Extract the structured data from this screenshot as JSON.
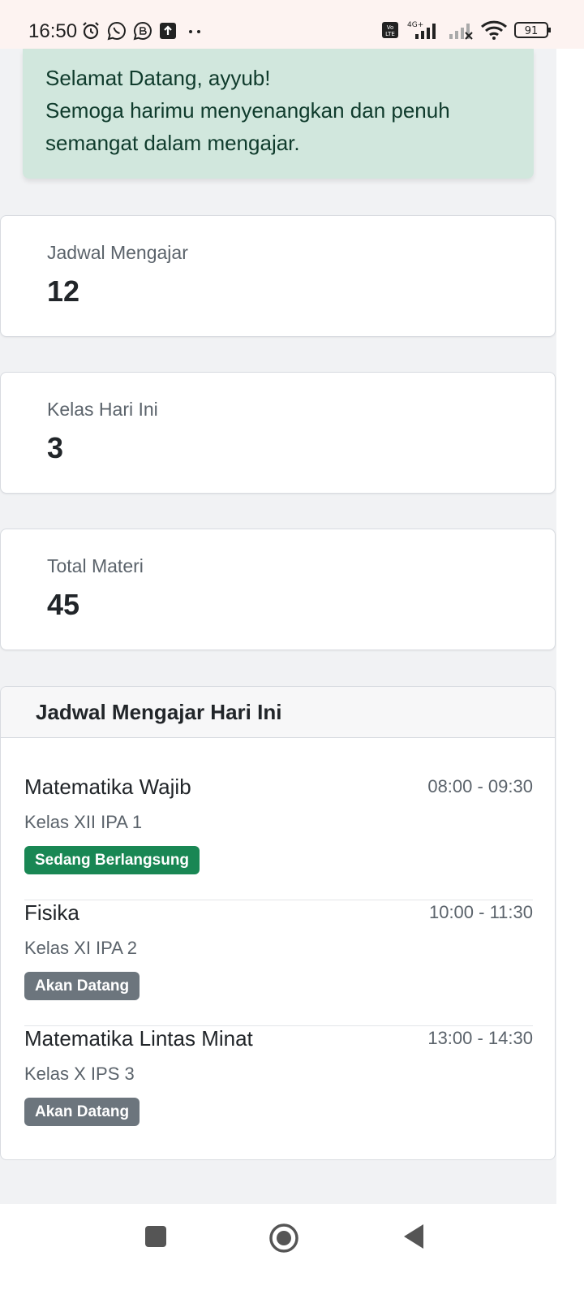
{
  "status_bar": {
    "time": "16:50",
    "left_icons": [
      "alarm-icon",
      "whatsapp-icon",
      "whatsapp-business-icon",
      "upload-icon",
      "more-dots-icon"
    ],
    "right_icons": [
      "volte-icon",
      "signal-4g-icon",
      "signal-no-service-icon",
      "wifi-icon",
      "battery-icon"
    ],
    "network_label": "4G+",
    "battery": "91"
  },
  "welcome": {
    "line1": "Selamat Datang, ayyub!",
    "line2": "Semoga harimu menyenangkan dan penuh semangat dalam mengajar."
  },
  "stats": [
    {
      "label": "Jadwal Mengajar",
      "value": "12"
    },
    {
      "label": "Kelas Hari Ini",
      "value": "3"
    },
    {
      "label": "Total Materi",
      "value": "45"
    }
  ],
  "schedule": {
    "title": "Jadwal Mengajar Hari Ini",
    "items": [
      {
        "subject": "Matematika Wajib",
        "time": "08:00 - 09:30",
        "class": "Kelas XII IPA 1",
        "status": "Sedang Berlangsung"
      },
      {
        "subject": "Fisika",
        "time": "10:00 - 11:30",
        "class": "Kelas XI IPA 2",
        "status": "Akan Datang"
      },
      {
        "subject": "Matematika Lintas Minat",
        "time": "13:00 - 14:30",
        "class": "Kelas X IPS 3",
        "status": "Akan Datang"
      }
    ]
  },
  "nav": {
    "icons": [
      "recents-square-icon",
      "home-circle-icon",
      "back-triangle-icon"
    ]
  },
  "colors": {
    "welcome_bg": "#d1e7dd",
    "badge_active": "#198754",
    "badge_upcoming": "#6c757d",
    "page_bg": "#f1f2f4"
  }
}
